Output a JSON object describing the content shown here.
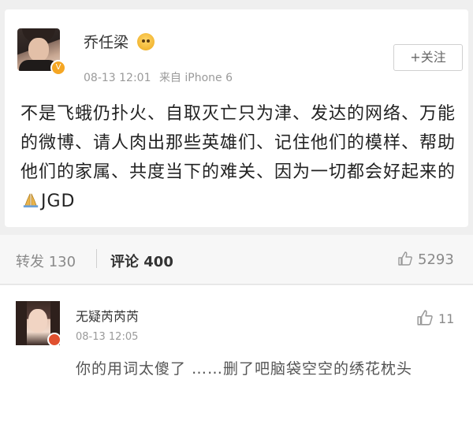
{
  "post": {
    "author_name": "乔任梁",
    "timestamp": "08-13 12:01",
    "source": "来自 iPhone 6",
    "follow_label": "+关注",
    "text_part1": "不是飞蛾仍扑火、自取灭亡只为津、发达的网络、万能的微博、请人肉出那些英雄们、记住他们的模样、帮助他们的家属、共度当下的难关、因为一切都会好起来的",
    "text_part2": "JGD",
    "emoji_names": [
      "surprised-face-emoji",
      "praying-hands-emoji"
    ]
  },
  "actions": {
    "repost_label": "转发 130",
    "comment_label": "评论 400",
    "like_count": "5293"
  },
  "comment": {
    "author_name": "无疑芮芮芮",
    "timestamp": "08-13 12:05",
    "like_count": "11",
    "text": "你的用词太傻了 ……删了吧脑袋空空的绣花枕头"
  },
  "colors": {
    "background": "#efefef",
    "card": "#ffffff",
    "meta_gray": "#9a9a9a",
    "vip_badge": "#f5a623",
    "comment_badge": "#e0502f"
  }
}
